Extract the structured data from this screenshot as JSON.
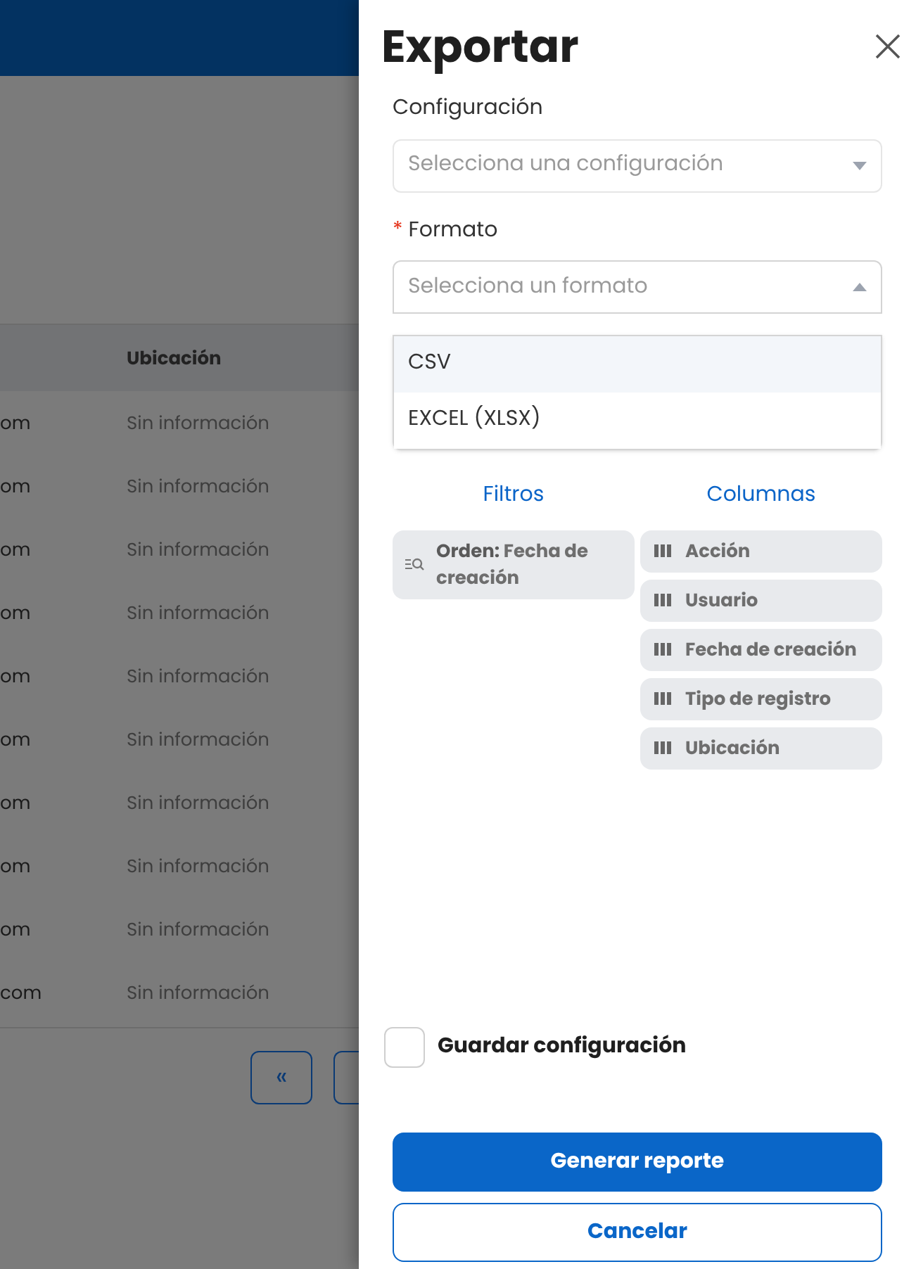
{
  "background_table": {
    "columns": [
      null,
      {
        "label": "Ubicación"
      }
    ],
    "rows": [
      [
        "om",
        "Sin información"
      ],
      [
        "om",
        "Sin información"
      ],
      [
        "om",
        "Sin información"
      ],
      [
        "om",
        "Sin información"
      ],
      [
        "om",
        "Sin información"
      ],
      [
        "om",
        "Sin información"
      ],
      [
        "om",
        "Sin información"
      ],
      [
        "om",
        "Sin información"
      ],
      [
        "om",
        "Sin información"
      ],
      [
        "com",
        "Sin información"
      ]
    ],
    "pagination": [
      "«"
    ]
  },
  "drawer": {
    "title": "Exportar",
    "fields": [
      {
        "label": "Configuración",
        "placeholder": "Selecciona una configuración",
        "expanded": false
      },
      {
        "label": "Formato",
        "required_mark": "*",
        "placeholder": "Selecciona un formato",
        "expanded": true,
        "options": [
          {
            "label": "CSV",
            "selected": true
          },
          {
            "label": "EXCEL (XLSX)",
            "selected": false
          }
        ]
      }
    ],
    "filters": {
      "title": "Filtros",
      "items": [
        {
          "key": "Orden:",
          "value": "Fecha de creación"
        }
      ]
    },
    "columns": {
      "title": "Columnas",
      "items": [
        "Acción",
        "Usuario",
        "Fecha de creación",
        "Tipo de registro",
        "Ubicación"
      ]
    },
    "save_config": {
      "label": "Guardar configuración",
      "checked": false
    },
    "buttons": [
      {
        "label": "Generar reporte",
        "kind": "primary"
      },
      {
        "label": "Cancelar",
        "kind": "secondary"
      }
    ]
  }
}
